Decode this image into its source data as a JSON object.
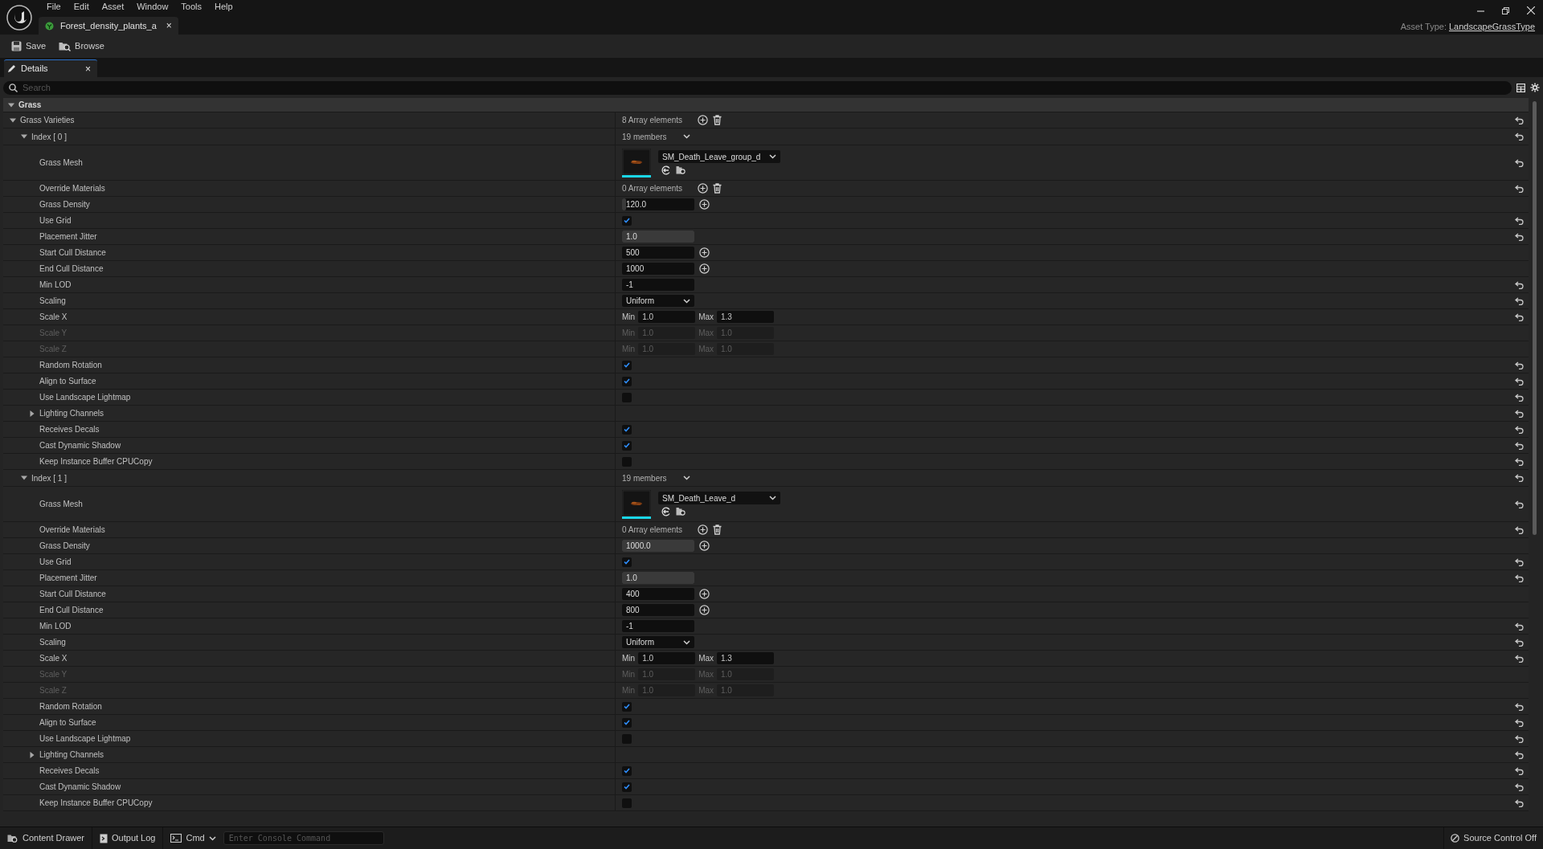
{
  "menu": [
    "File",
    "Edit",
    "Asset",
    "Window",
    "Tools",
    "Help"
  ],
  "document_tab": {
    "label": "Forest_density_plants_a",
    "close": "×"
  },
  "asset_type": {
    "label": "Asset Type:",
    "value": "LandscapeGrassType"
  },
  "toolbar": [
    "Save",
    "Browse"
  ],
  "panel_tab": {
    "label": "Details",
    "close": "×"
  },
  "search": {
    "placeholder": "Search"
  },
  "category": {
    "label": "Grass",
    "expanded": true
  },
  "array": {
    "label": "Grass Varieties",
    "value": "8 Array elements",
    "expanded": true,
    "reset": true,
    "elements": [
      {
        "label": "Index [ 0 ]",
        "value": "19 members",
        "expanded": true,
        "reset": true,
        "children": [
          {
            "kind": "mesh",
            "label": "Grass Mesh",
            "value": "SM_Death_Leave_group_d",
            "reset": true
          },
          {
            "kind": "array",
            "label": "Override Materials",
            "value": "0 Array elements",
            "reset": true
          },
          {
            "kind": "number",
            "label": "Grass Density",
            "value": "120.0",
            "level": 0.05,
            "add": true,
            "reset": false
          },
          {
            "kind": "checkbox",
            "label": "Use Grid",
            "checked": true,
            "reset": true
          },
          {
            "kind": "number",
            "label": "Placement Jitter",
            "value": "1.0",
            "level": 1,
            "add": false,
            "reset": true
          },
          {
            "kind": "number",
            "label": "Start Cull Distance",
            "value": "500",
            "add": true,
            "reset": false
          },
          {
            "kind": "number",
            "label": "End Cull Distance",
            "value": "1000",
            "add": true,
            "reset": false
          },
          {
            "kind": "number",
            "label": "Min LOD",
            "value": "-1",
            "add": false,
            "reset": true
          },
          {
            "kind": "dropdown",
            "label": "Scaling",
            "value": "Uniform",
            "reset": true
          },
          {
            "kind": "range",
            "label": "Scale X",
            "min_label": "Min",
            "min": "1.0",
            "max_label": "Max",
            "max": "1.3",
            "disabled": false,
            "reset": true
          },
          {
            "kind": "range",
            "label": "Scale Y",
            "min_label": "Min",
            "min": "1.0",
            "max_label": "Max",
            "max": "1.0",
            "disabled": true,
            "reset": false
          },
          {
            "kind": "range",
            "label": "Scale Z",
            "min_label": "Min",
            "min": "1.0",
            "max_label": "Max",
            "max": "1.0",
            "disabled": true,
            "reset": false
          },
          {
            "kind": "checkbox",
            "label": "Random Rotation",
            "checked": true,
            "reset": true
          },
          {
            "kind": "checkbox",
            "label": "Align to Surface",
            "checked": true,
            "reset": true
          },
          {
            "kind": "checkbox",
            "label": "Use Landscape Lightmap",
            "checked": false,
            "reset": true
          },
          {
            "kind": "group",
            "label": "Lighting Channels",
            "expanded": false,
            "reset": true
          },
          {
            "kind": "checkbox",
            "label": "Receives Decals",
            "checked": true,
            "reset": true
          },
          {
            "kind": "checkbox",
            "label": "Cast Dynamic Shadow",
            "checked": true,
            "reset": true
          },
          {
            "kind": "checkbox",
            "label": "Keep Instance Buffer CPUCopy",
            "checked": false,
            "reset": true
          }
        ]
      },
      {
        "label": "Index [ 1 ]",
        "value": "19 members",
        "expanded": true,
        "reset": true,
        "children": [
          {
            "kind": "mesh",
            "label": "Grass Mesh",
            "value": "SM_Death_Leave_d",
            "reset": true
          },
          {
            "kind": "array",
            "label": "Override Materials",
            "value": "0 Array elements",
            "reset": true
          },
          {
            "kind": "number",
            "label": "Grass Density",
            "value": "1000.0",
            "level": 1,
            "add": true,
            "reset": false
          },
          {
            "kind": "checkbox",
            "label": "Use Grid",
            "checked": true,
            "reset": true
          },
          {
            "kind": "number",
            "label": "Placement Jitter",
            "value": "1.0",
            "level": 1,
            "add": false,
            "reset": true
          },
          {
            "kind": "number",
            "label": "Start Cull Distance",
            "value": "400",
            "add": true,
            "reset": false
          },
          {
            "kind": "number",
            "label": "End Cull Distance",
            "value": "800",
            "add": true,
            "reset": false
          },
          {
            "kind": "number",
            "label": "Min LOD",
            "value": "-1",
            "add": false,
            "reset": true
          },
          {
            "kind": "dropdown",
            "label": "Scaling",
            "value": "Uniform",
            "reset": true
          },
          {
            "kind": "range",
            "label": "Scale X",
            "min_label": "Min",
            "min": "1.0",
            "max_label": "Max",
            "max": "1.3",
            "disabled": false,
            "reset": true
          },
          {
            "kind": "range",
            "label": "Scale Y",
            "min_label": "Min",
            "min": "1.0",
            "max_label": "Max",
            "max": "1.0",
            "disabled": true,
            "reset": false
          },
          {
            "kind": "range",
            "label": "Scale Z",
            "min_label": "Min",
            "min": "1.0",
            "max_label": "Max",
            "max": "1.0",
            "disabled": true,
            "reset": false
          },
          {
            "kind": "checkbox",
            "label": "Random Rotation",
            "checked": true,
            "reset": true
          },
          {
            "kind": "checkbox",
            "label": "Align to Surface",
            "checked": true,
            "reset": true
          },
          {
            "kind": "checkbox",
            "label": "Use Landscape Lightmap",
            "checked": false,
            "reset": true
          },
          {
            "kind": "group",
            "label": "Lighting Channels",
            "expanded": false,
            "reset": true
          },
          {
            "kind": "checkbox",
            "label": "Receives Decals",
            "checked": true,
            "reset": true
          },
          {
            "kind": "checkbox",
            "label": "Cast Dynamic Shadow",
            "checked": true,
            "reset": true
          },
          {
            "kind": "checkbox",
            "label": "Keep Instance Buffer CPUCopy",
            "checked": false,
            "reset": true
          }
        ]
      }
    ]
  },
  "status_bar": {
    "items": [
      "Content Drawer",
      "Output Log"
    ],
    "cmd": "Cmd",
    "console_placeholder": "Enter Console Command",
    "source_control": "Source Control Off"
  }
}
